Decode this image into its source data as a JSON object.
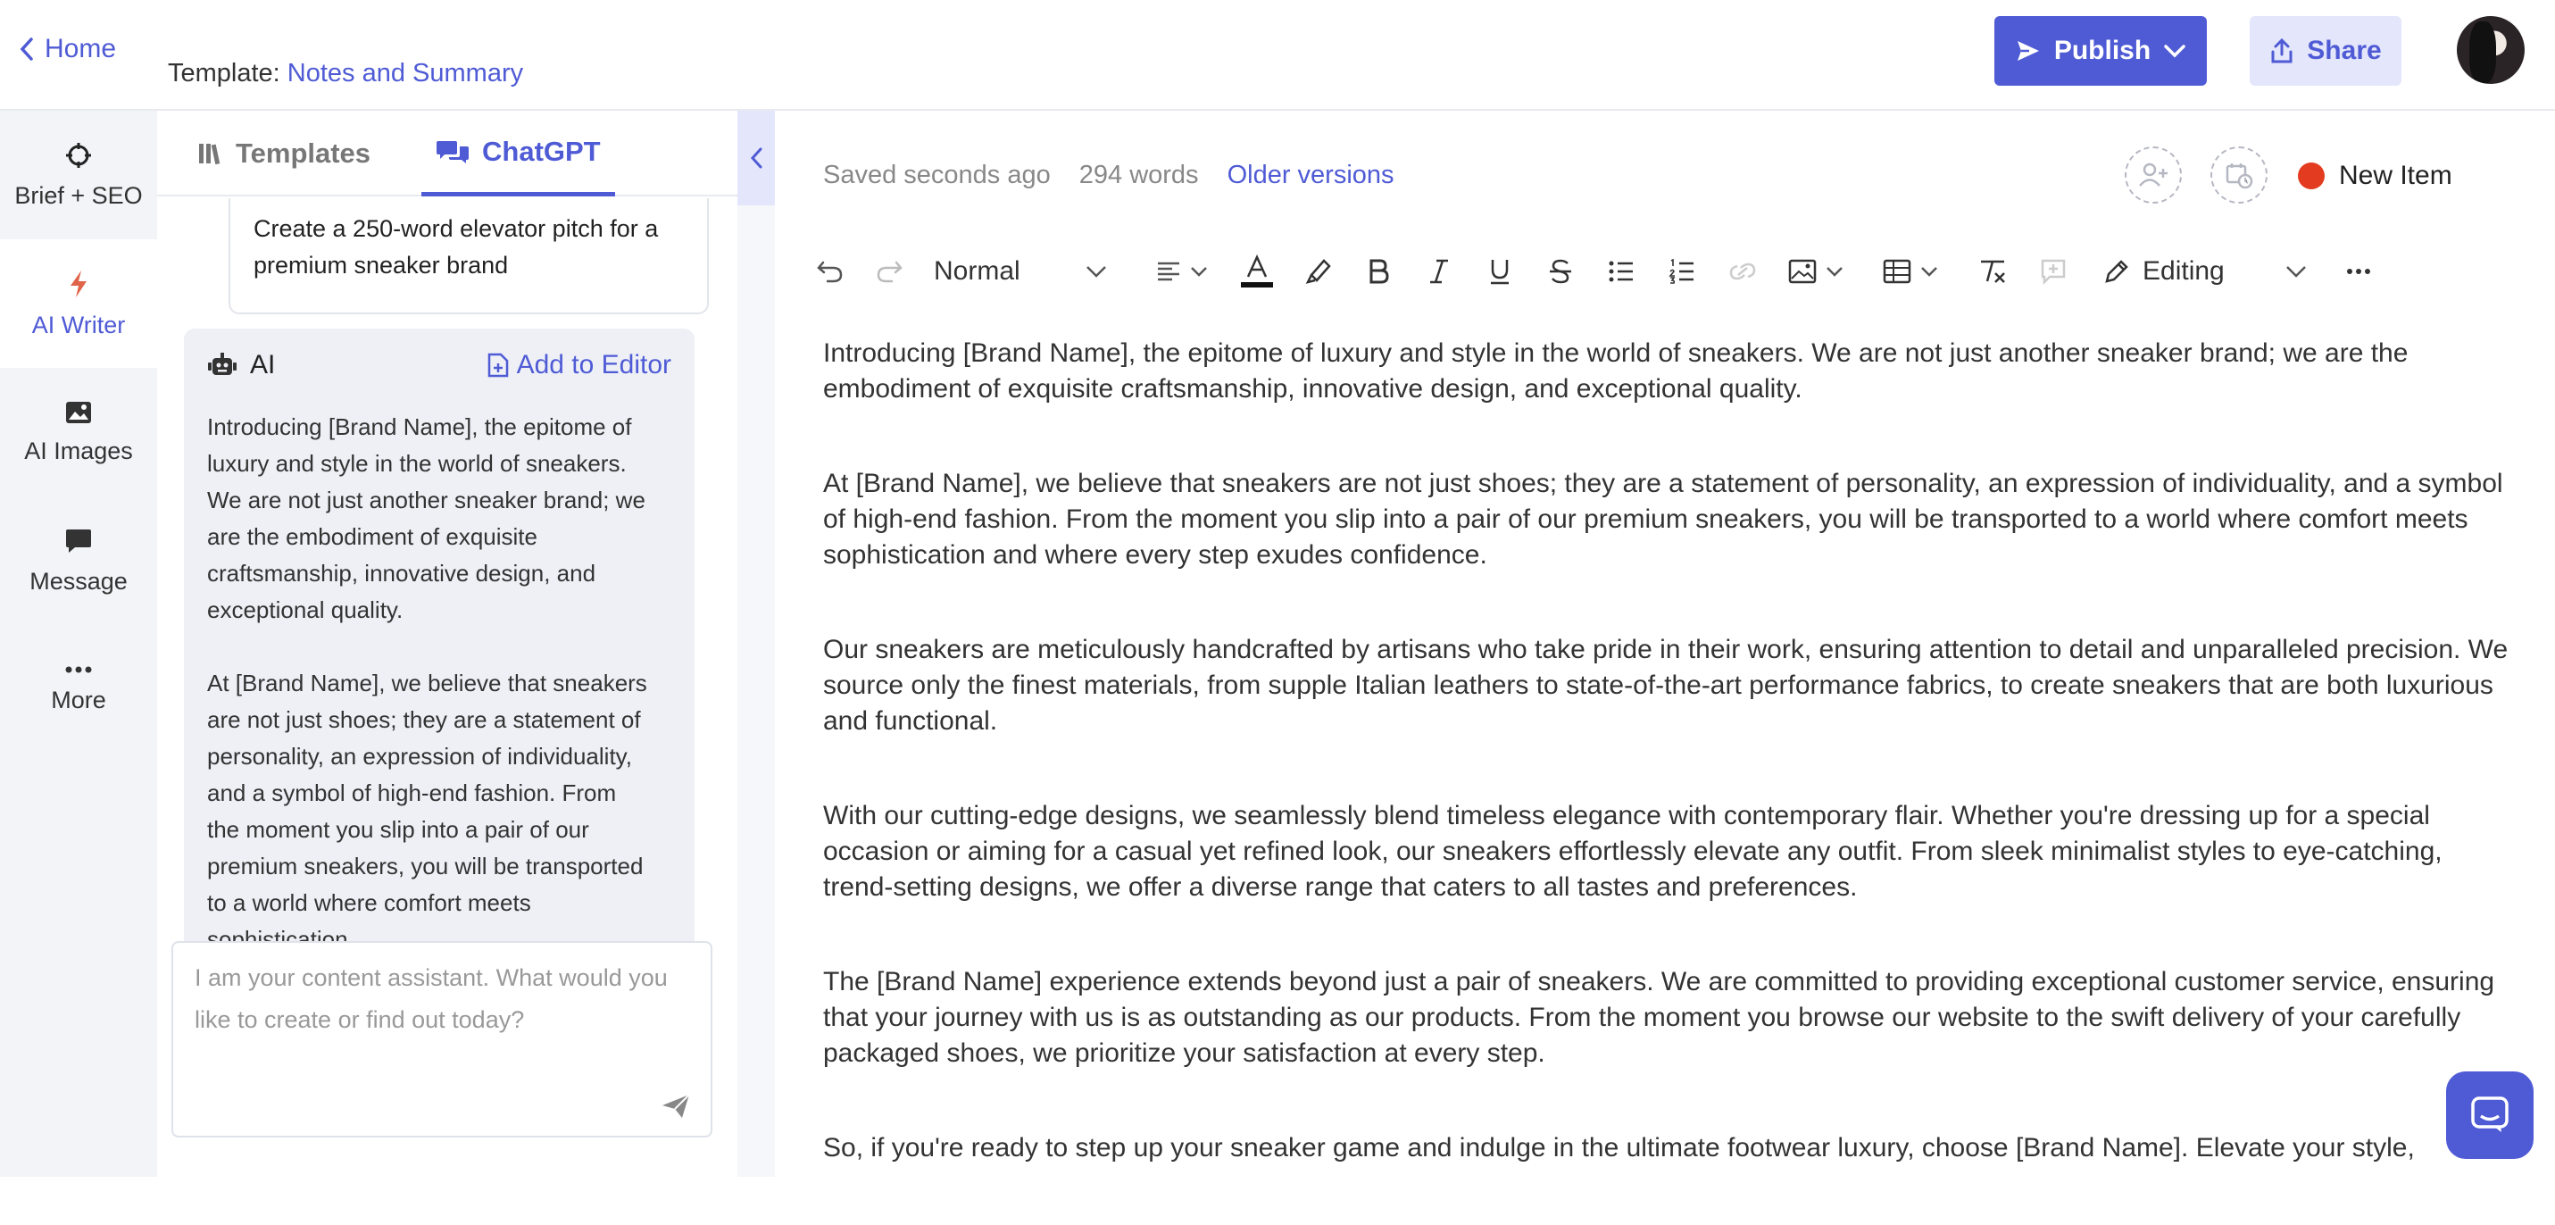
{
  "header": {
    "home_label": "Home",
    "template_prefix": "Template:",
    "template_name": "Notes and Summary",
    "publish_label": "Publish",
    "share_label": "Share"
  },
  "leftnav": {
    "items": [
      {
        "label": "Brief + SEO",
        "icon": "crosshair-icon"
      },
      {
        "label": "AI Writer",
        "icon": "lightning-icon"
      },
      {
        "label": "AI Images",
        "icon": "image-icon"
      },
      {
        "label": "Message",
        "icon": "chat-icon"
      },
      {
        "label": "More",
        "icon": "ellipsis-icon"
      }
    ],
    "active": "AI Writer"
  },
  "panel": {
    "tabs": [
      {
        "label": "Templates"
      },
      {
        "label": "ChatGPT"
      }
    ],
    "prompt": "Create a 250-word elevator pitch for a premium sneaker brand",
    "ai_label": "AI",
    "add_to_editor": "Add to Editor",
    "ai_paragraphs": [
      "Introducing [Brand Name], the epitome of luxury and style in the world of sneakers. We are not just another sneaker brand; we are the embodiment of exquisite craftsmanship, innovative design, and exceptional quality.",
      "At [Brand Name], we believe that sneakers are not just shoes; they are a statement of personality, an expression of individuality, and a symbol of high-end fashion. From the moment you slip into a pair of our premium sneakers, you will be transported to a world where comfort meets sophistication"
    ],
    "assistant_placeholder": "I am your content assistant. What would you like to create or find out today?"
  },
  "editor": {
    "saved": "Saved seconds ago",
    "words": "294 words",
    "older_versions": "Older versions",
    "new_item": "New Item",
    "toolbar": {
      "style": "Normal",
      "mode": "Editing"
    },
    "paragraphs": [
      "Introducing [Brand Name], the epitome of luxury and style in the world of sneakers. We are not just another sneaker brand; we are the embodiment of exquisite craftsmanship, innovative design, and exceptional quality.",
      "At [Brand Name], we believe that sneakers are not just shoes; they are a statement of personality, an expression of individuality, and a symbol of high-end fashion. From the moment you slip into a pair of our premium sneakers, you will be transported to a world where comfort meets sophistication and where every step exudes confidence.",
      "Our sneakers are meticulously handcrafted by artisans who take pride in their work, ensuring attention to detail and unparalleled precision. We source only the finest materials, from supple Italian leathers to state-of-the-art performance fabrics, to create sneakers that are both luxurious and functional.",
      "With our cutting-edge designs, we seamlessly blend timeless elegance with contemporary flair. Whether you're dressing up for a special occasion or aiming for a casual yet refined look, our sneakers effortlessly elevate any outfit. From sleek minimalist styles to eye-catching, trend-setting designs, we offer a diverse range that caters to all tastes and preferences.",
      "The [Brand Name] experience extends beyond just a pair of sneakers. We are committed to providing exceptional customer service, ensuring that your journey with us is as outstanding as our products. From the moment you browse our website to the swift delivery of your carefully packaged shoes, we prioritize your satisfaction at every step.",
      "So, if you're ready to step up your sneaker game and indulge in the ultimate footwear luxury, choose [Brand Name]. Elevate your style,"
    ]
  },
  "colors": {
    "accent": "#4f5bd5",
    "status_dot": "#e33b1f"
  }
}
